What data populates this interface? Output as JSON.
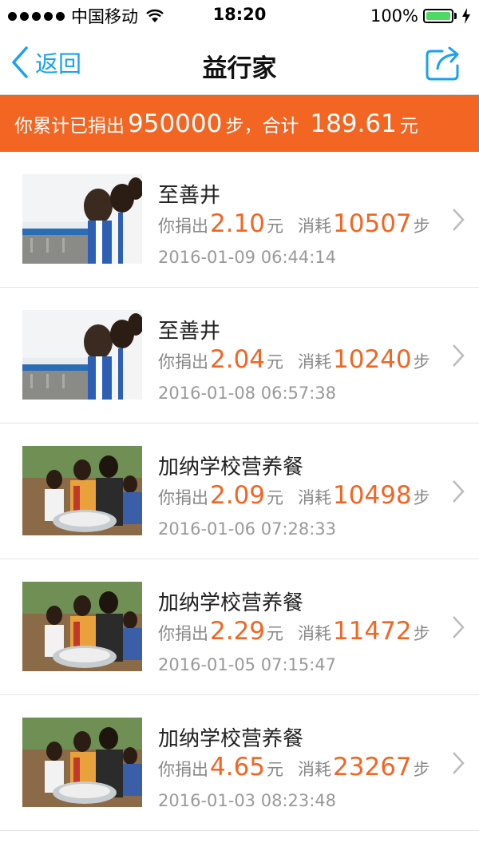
{
  "status_bar": {
    "carrier": "中国移动",
    "time": "18:20",
    "battery": "100%"
  },
  "nav": {
    "back_label": "返回",
    "title": "益行家"
  },
  "summary": {
    "prefix": "你累计已捐出",
    "steps": "950000",
    "steps_unit": "步，",
    "total_label": "合计",
    "amount": "189.61",
    "amount_unit": "元"
  },
  "items": [
    {
      "title": "至善井",
      "donated_label": "你捐出",
      "amount": "2.10",
      "amount_unit": "元",
      "consumed_label": "消耗",
      "steps": "10507",
      "steps_unit": "步",
      "date": "2016-01-09 06:44:14",
      "image": "well-photo"
    },
    {
      "title": "至善井",
      "donated_label": "你捐出",
      "amount": "2.04",
      "amount_unit": "元",
      "consumed_label": "消耗",
      "steps": "10240",
      "steps_unit": "步",
      "date": "2016-01-08 06:57:38",
      "image": "well-photo"
    },
    {
      "title": "加纳学校营养餐",
      "donated_label": "你捐出",
      "amount": "2.09",
      "amount_unit": "元",
      "consumed_label": "消耗",
      "steps": "10498",
      "steps_unit": "步",
      "date": "2016-01-06 07:28:33",
      "image": "meal-photo"
    },
    {
      "title": "加纳学校营养餐",
      "donated_label": "你捐出",
      "amount": "2.29",
      "amount_unit": "元",
      "consumed_label": "消耗",
      "steps": "11472",
      "steps_unit": "步",
      "date": "2016-01-05 07:15:47",
      "image": "meal-photo"
    },
    {
      "title": "加纳学校营养餐",
      "donated_label": "你捐出",
      "amount": "4.65",
      "amount_unit": "元",
      "consumed_label": "消耗",
      "steps": "23267",
      "steps_unit": "步",
      "date": "2016-01-03 08:23:48",
      "image": "meal-photo"
    }
  ],
  "colors": {
    "accent": "#f26522",
    "link": "#1aa1f0",
    "battery": "#4cd964"
  }
}
